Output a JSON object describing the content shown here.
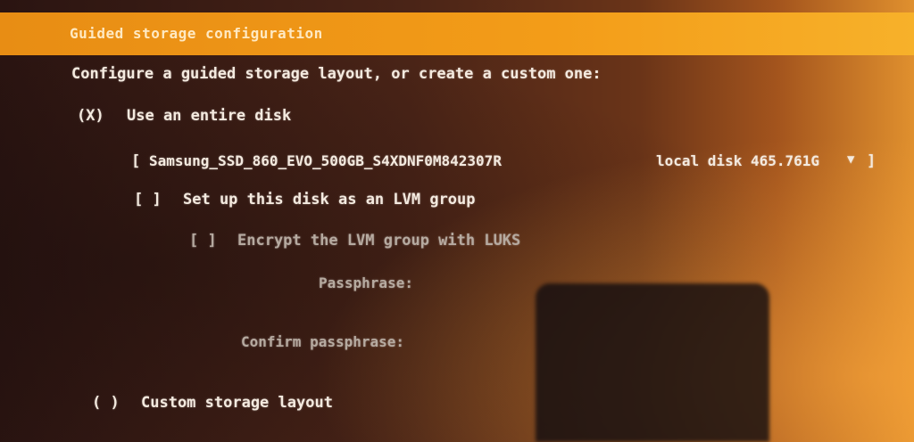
{
  "header": {
    "title": "Guided storage configuration"
  },
  "main": {
    "intro": "Configure a guided storage layout, or create a custom one:",
    "entire_disk": {
      "marker": "(X)",
      "label": "Use an entire disk"
    },
    "disk_select": {
      "open": "[",
      "value": "Samsung_SSD_860_EVO_500GB_S4XDNF0M842307R",
      "meta": "local disk 465.761G",
      "arrow": "▼",
      "close": "]"
    },
    "lvm": {
      "marker": "[ ]",
      "label": "Set up this disk as an LVM group"
    },
    "encrypt": {
      "marker": "[ ]",
      "label": "Encrypt the LVM group with LUKS"
    },
    "passphrase_label": "Passphrase:",
    "confirm_label": "Confirm passphrase:",
    "custom": {
      "marker": "( )",
      "label": "Custom storage layout"
    }
  },
  "colors": {
    "title_bar": "#f39c18",
    "text": "#f4eadf",
    "dim_text": "#b6aaa0"
  }
}
